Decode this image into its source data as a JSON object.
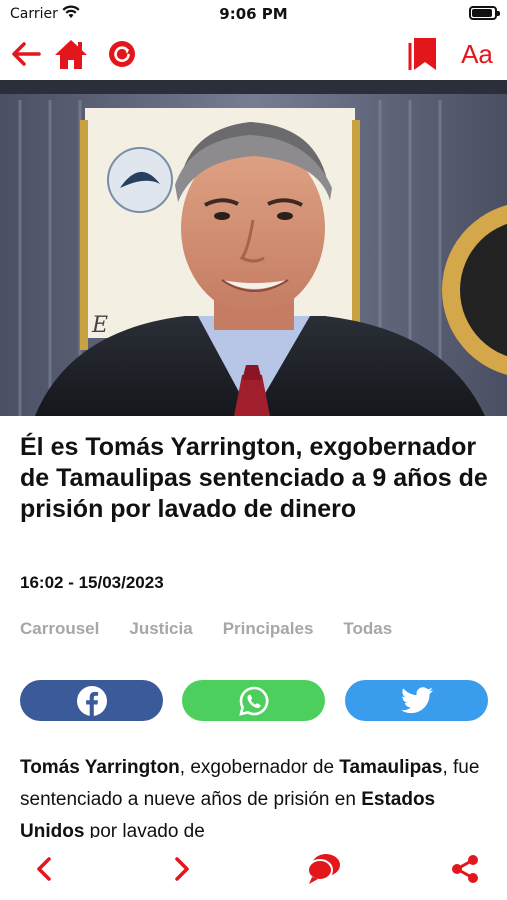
{
  "status_bar": {
    "carrier": "Carrier",
    "time": "9:06 PM"
  },
  "toolbar": {
    "text_size_label": "Aa",
    "icons": [
      "back-arrow-icon",
      "home-icon",
      "reload-icon",
      "bookmark-icon"
    ]
  },
  "hero_image": {
    "description_icon": "news-photo"
  },
  "article": {
    "title": "Él es Tomás Yarrington, exgobernador de Tamaulipas sentenciado a 9 años de prisión por lavado de dinero",
    "timestamp": "16:02 - 15/03/2023",
    "tags": [
      "Carrousel",
      "Justicia",
      "Principales",
      "Todas"
    ],
    "body": {
      "s1_bold": "Tomás Yarrington",
      "s2": ", exgobernador de ",
      "s3_bold": "Tamaulipas",
      "s4": ", fue sentenciado a nueve años de prisión en ",
      "s5_bold": "Estados Unidos",
      "s6": " por lavado de"
    }
  },
  "share": {
    "buttons": [
      "facebook-icon",
      "whatsapp-icon",
      "twitter-icon"
    ]
  },
  "bottom_bar": {
    "icons": [
      "previous-icon",
      "next-icon",
      "comments-icon",
      "share-icon"
    ]
  },
  "colors": {
    "accent": "#e3161c",
    "facebook": "#3a5a9a",
    "whatsapp": "#4ccf5c",
    "twitter": "#3a9cec",
    "tag_gray": "#a7a7a7"
  }
}
